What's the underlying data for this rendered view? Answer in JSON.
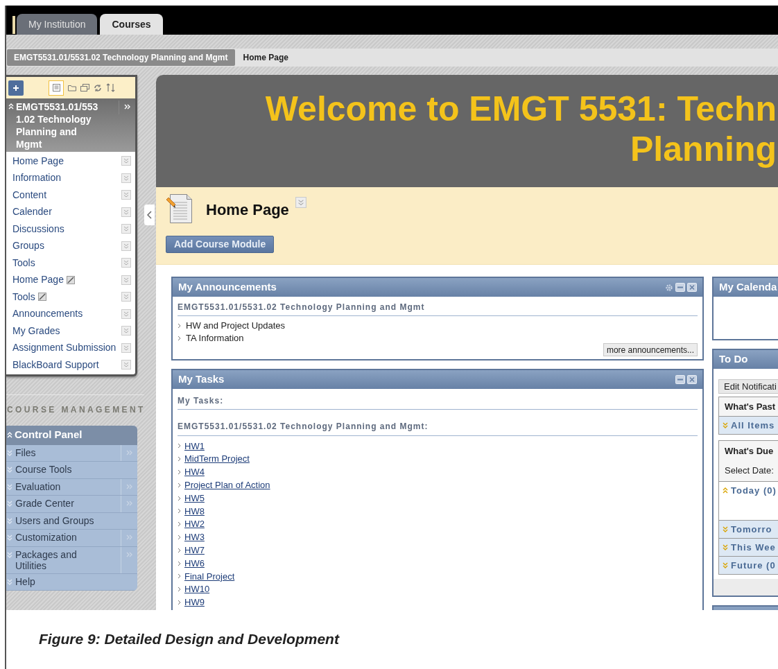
{
  "tabs": [
    {
      "label": "My Institution",
      "selected": false
    },
    {
      "label": "Courses",
      "selected": true
    }
  ],
  "breadcrumbs": [
    {
      "label": "EMGT5531.01/5531.02 Technology Planning and Mgmt",
      "current": false
    },
    {
      "label": "Home Page",
      "current": true
    }
  ],
  "course_menu": {
    "title": "EMGT5531.01/5531.02 Technology Planning and Mgmt",
    "items": [
      {
        "label": "Home Page",
        "hidden": false
      },
      {
        "label": "Information",
        "hidden": false
      },
      {
        "label": "Content",
        "hidden": false
      },
      {
        "label": "Calender",
        "hidden": false
      },
      {
        "label": "Discussions",
        "hidden": false
      },
      {
        "label": "Groups",
        "hidden": false
      },
      {
        "label": "Tools",
        "hidden": false
      },
      {
        "label": "Home Page",
        "hidden": true
      },
      {
        "label": "Tools",
        "hidden": true
      },
      {
        "label": "Announcements",
        "hidden": false
      },
      {
        "label": "My Grades",
        "hidden": false
      },
      {
        "label": "Assignment Submission",
        "hidden": false
      },
      {
        "label": "BlackBoard Support",
        "hidden": false
      }
    ]
  },
  "course_management": {
    "heading": "COURSE MANAGEMENT",
    "panel_title": "Control Panel",
    "items": [
      {
        "label": "Files",
        "submenu": true
      },
      {
        "label": "Course Tools",
        "submenu": false
      },
      {
        "label": "Evaluation",
        "submenu": true
      },
      {
        "label": "Grade Center",
        "submenu": true
      },
      {
        "label": "Users and Groups",
        "submenu": false
      },
      {
        "label": "Customization",
        "submenu": true
      },
      {
        "label": "Packages and Utilities",
        "submenu": true
      },
      {
        "label": "Help",
        "submenu": false
      }
    ]
  },
  "banner": {
    "lines": [
      "Welcome to EMGT 5531: Techn",
      "Planning"
    ]
  },
  "page_header": {
    "title": "Home Page",
    "button": "Add Course Module"
  },
  "announcements": {
    "title": "My Announcements",
    "course": "EMGT5531.01/5531.02 Technology Planning and Mgmt",
    "items": [
      "HW and Project Updates",
      "TA Information"
    ],
    "more_button": "more announcements..."
  },
  "tasks": {
    "title": "My Tasks",
    "subtitle": "My Tasks:",
    "course": "EMGT5531.01/5531.02 Technology Planning and Mgmt:",
    "items": [
      "HW1",
      "MidTerm Project",
      "HW4",
      "Project Plan of Action",
      "HW5",
      "HW8",
      "HW2",
      "HW3",
      "HW7",
      "HW6",
      "Final Project",
      "HW10",
      "HW9"
    ]
  },
  "calendar": {
    "title": "My Calenda"
  },
  "todo": {
    "title": "To Do",
    "edit_button": "Edit Notificati",
    "past_heading": "What's Past",
    "past_items": [
      {
        "label": "All Items",
        "expanded": false
      }
    ],
    "due_heading": "What's Due",
    "select_date": "Select Date:",
    "due_groups": [
      {
        "label": "Today (0)",
        "expanded": true
      },
      {
        "label": "Tomorro",
        "expanded": false
      },
      {
        "label": "This Wee",
        "expanded": false
      },
      {
        "label": "Future (0",
        "expanded": false
      }
    ]
  },
  "caption": "Figure 9: Detailed Design and Development"
}
